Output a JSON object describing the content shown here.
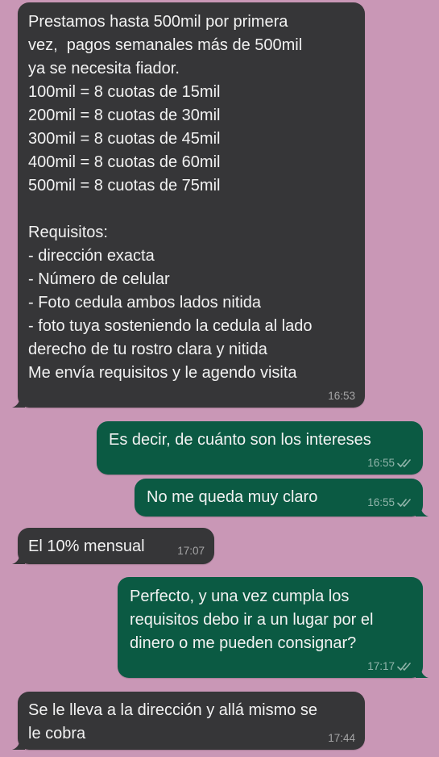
{
  "colors": {
    "background": "#c997b6",
    "incoming_bubble": "#363638",
    "outgoing_bubble": "#0b5a43",
    "text": "#f2f2f2",
    "meta": "#bdbdbd"
  },
  "messages": [
    {
      "direction": "incoming",
      "text": "Prestamos hasta 500mil por primera\nvez,  pagos semanales más de 500mil\nya se necesita fiador.\n100mil = 8 cuotas de 15mil\n200mil = 8 cuotas de 30mil\n300mil = 8 cuotas de 45mil\n400mil = 8 cuotas de 60mil\n500mil = 8 cuotas de 75mil\n\nRequisitos:\n- dirección exacta\n- Número de celular\n- Foto cedula ambos lados nitida\n- foto tuya sosteniendo la cedula al lado\nderecho de tu rostro clara y nitida\nMe envía requisitos y le agendo visita",
      "time": "16:53"
    },
    {
      "direction": "outgoing",
      "text": "Es decir, de cuánto son los intereses",
      "time": "16:55",
      "status_icon": "double-check-icon"
    },
    {
      "direction": "outgoing",
      "text": "No me queda muy claro",
      "time": "16:55",
      "status_icon": "double-check-icon"
    },
    {
      "direction": "incoming",
      "text": "El 10% mensual",
      "time": "17:07"
    },
    {
      "direction": "outgoing",
      "text": "Perfecto, y una vez cumpla los\nrequisitos debo ir a un lugar por el\ndinero o me pueden consignar?",
      "time": "17:17",
      "status_icon": "double-check-icon"
    },
    {
      "direction": "incoming",
      "text": "Se le lleva a la dirección y allá mismo se\nle cobra",
      "time": "17:44"
    }
  ]
}
